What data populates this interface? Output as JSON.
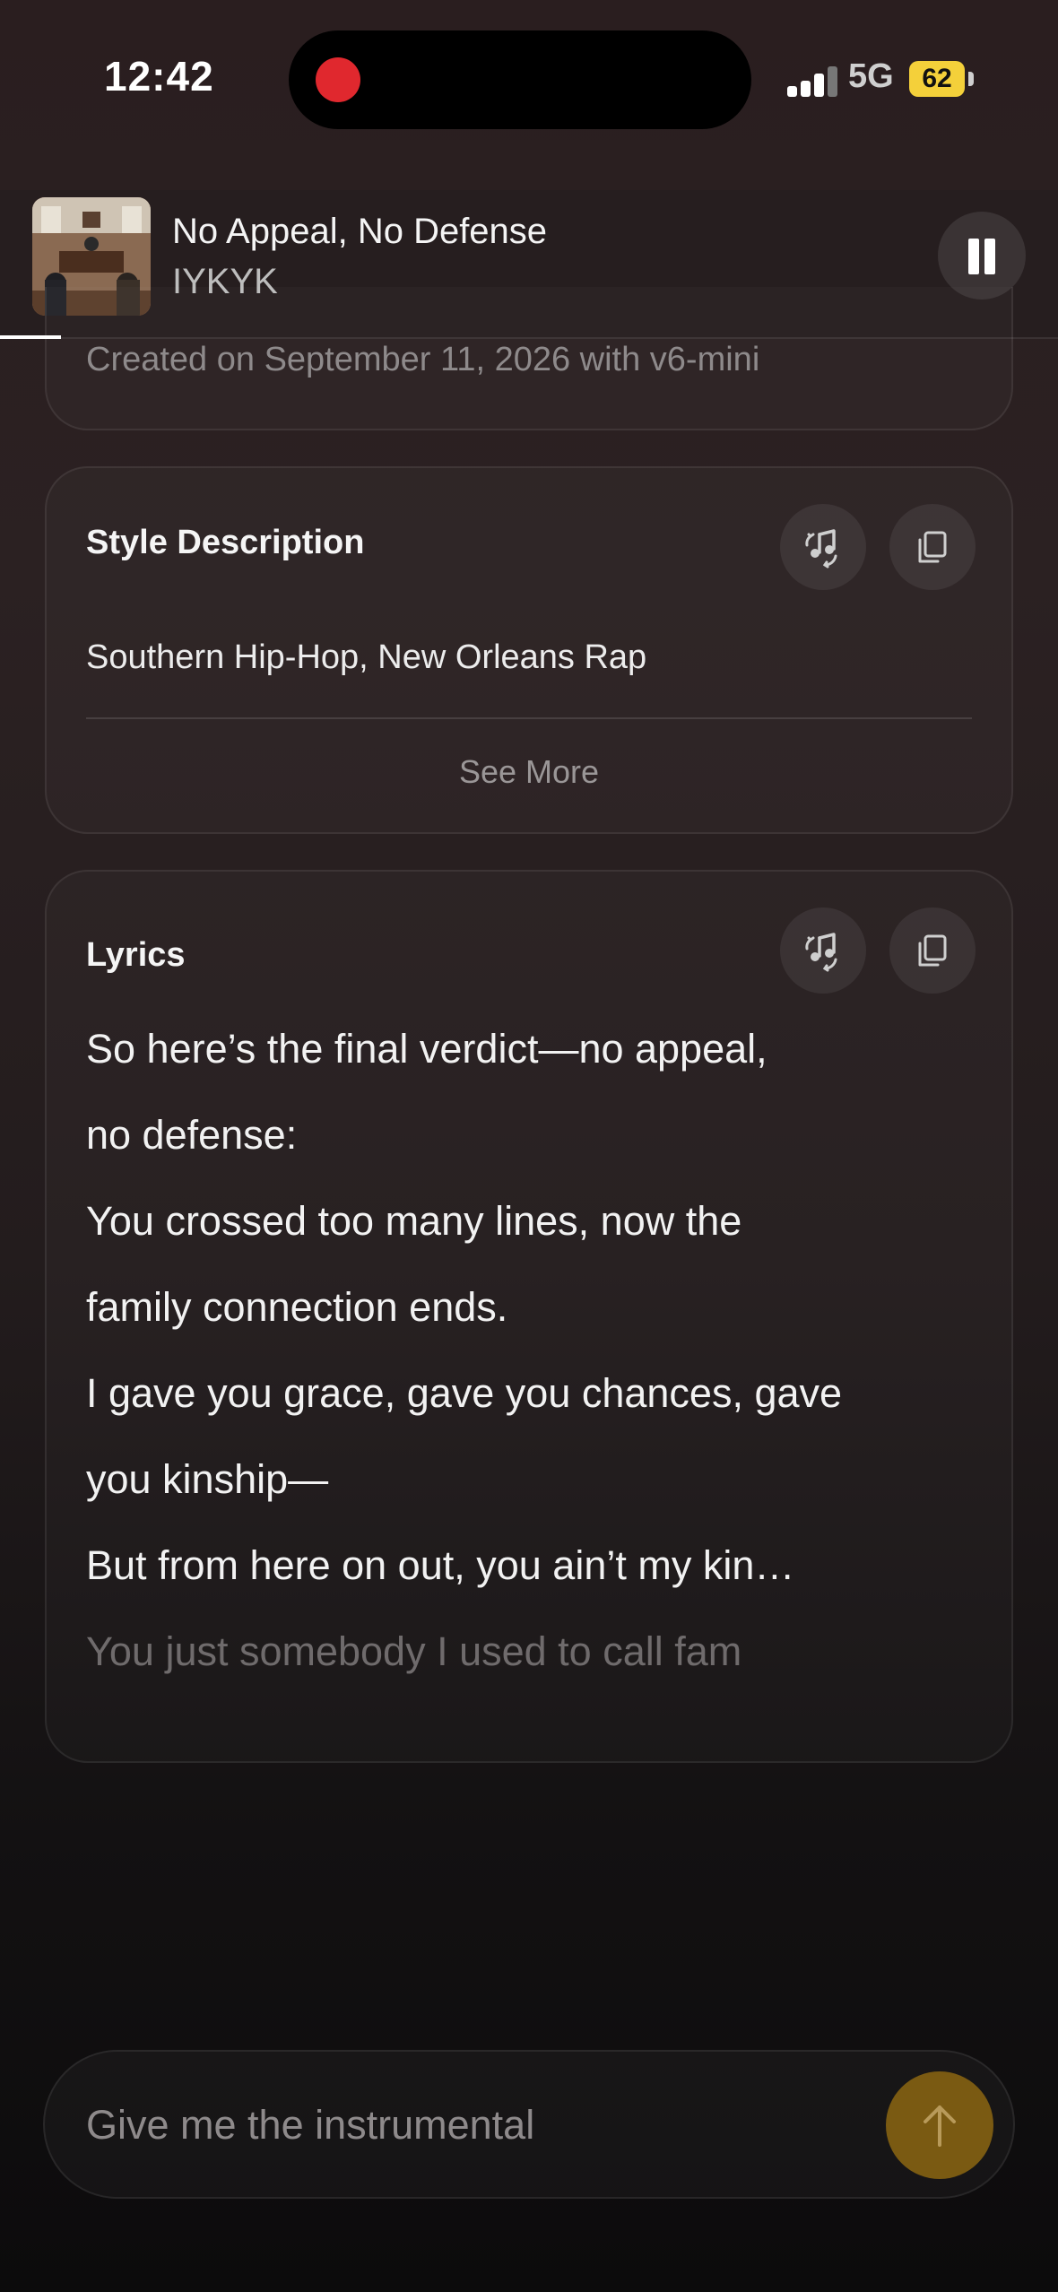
{
  "status_bar": {
    "time": "12:42",
    "network": "5G",
    "battery": "62"
  },
  "now_playing": {
    "title": "No Appeal, No Defense",
    "artist": "IYKYK"
  },
  "song_info": {
    "created": "Created on September 11, 2026 with v6-mini"
  },
  "style_card": {
    "title": "Style Description",
    "text": "Southern Hip-Hop, New Orleans Rap",
    "see_more": "See More"
  },
  "lyrics_card": {
    "title": "Lyrics",
    "lines": [
      "So here’s the final verdict—no appeal,",
      "no defense:",
      "You crossed too many lines, now the",
      "family connection ends.",
      "I gave you grace, gave you chances, gave",
      "you kinship—",
      "But from here on out, you ain’t my kin…",
      "You just somebody I used to call fam"
    ]
  },
  "prompt_input": {
    "value": "Give me the instrumental"
  },
  "icons": {
    "remix": "music-note-arrows-icon",
    "copy": "copy-icon",
    "pause": "pause-icon",
    "send": "arrow-up-icon"
  },
  "colors": {
    "accent": "#7a5a12",
    "record": "#e0282e",
    "battery": "#f4d03a"
  }
}
